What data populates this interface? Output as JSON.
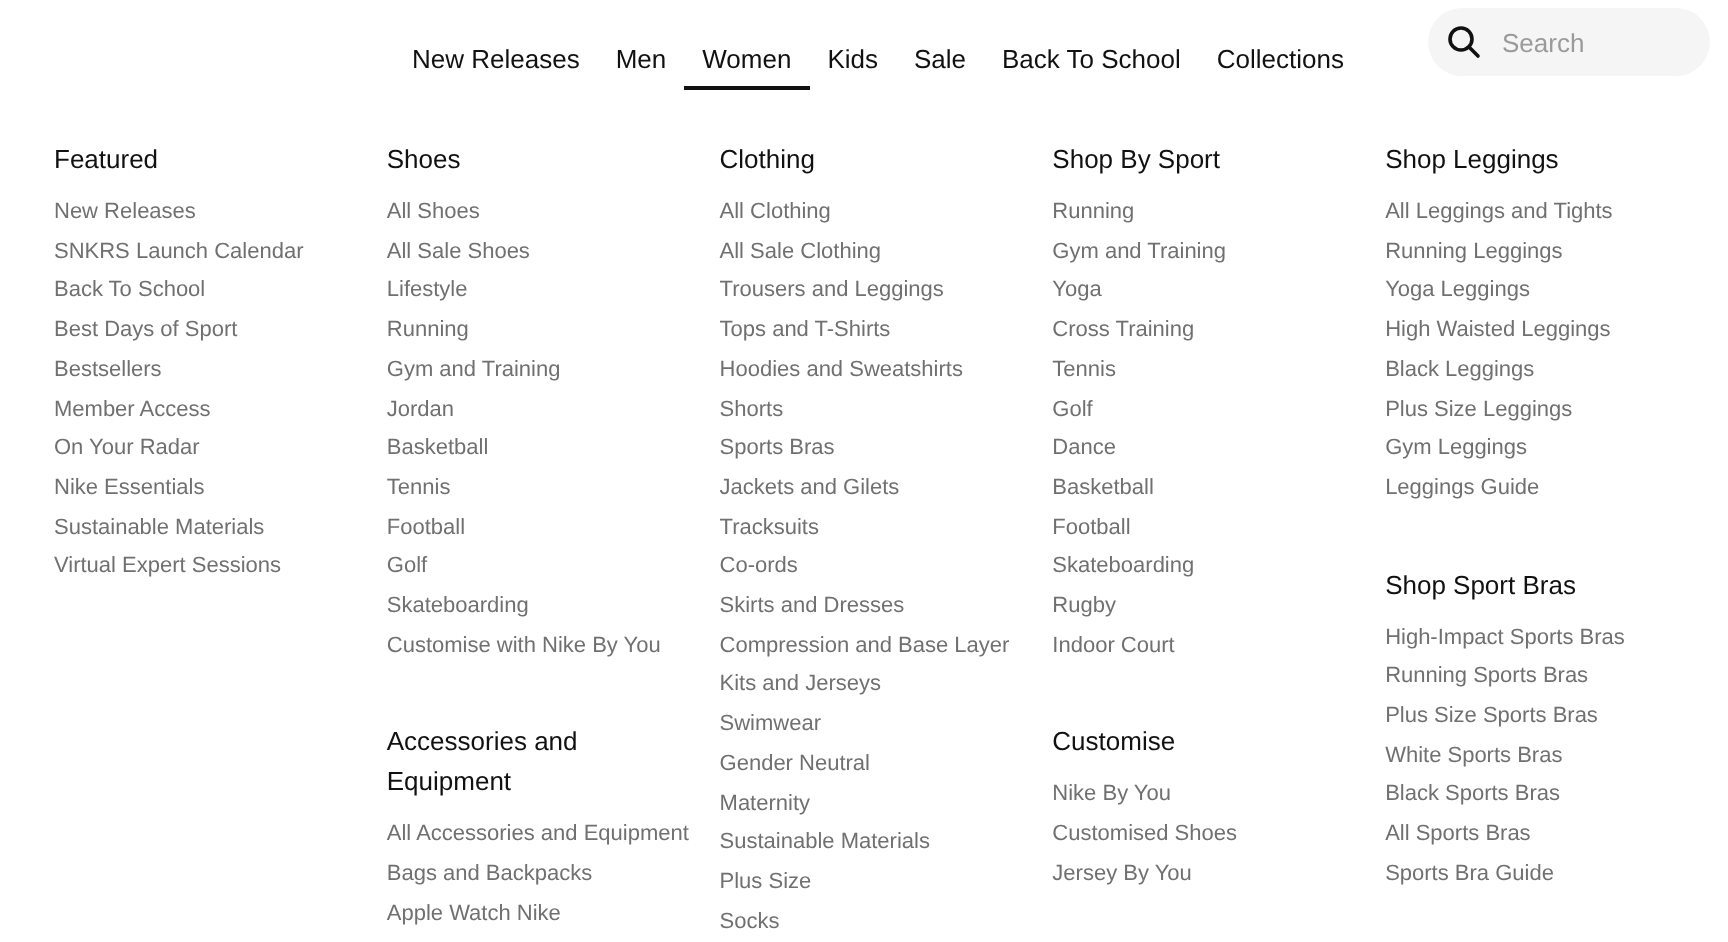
{
  "nav": [
    {
      "label": "New Releases",
      "selected": false
    },
    {
      "label": "Men",
      "selected": false
    },
    {
      "label": "Women",
      "selected": true
    },
    {
      "label": "Kids",
      "selected": false
    },
    {
      "label": "Sale",
      "selected": false
    },
    {
      "label": "Back To School",
      "selected": false
    },
    {
      "label": "Collections",
      "selected": false
    }
  ],
  "search": {
    "placeholder": "Search"
  },
  "columns": [
    {
      "sections": [
        {
          "heading": "Featured",
          "items": [
            "New Releases",
            "SNKRS Launch Calendar",
            "Back To School",
            "Best Days of Sport",
            "Bestsellers",
            "Member Access",
            "On Your Radar",
            "Nike Essentials",
            "Sustainable Materials",
            "Virtual Expert Sessions"
          ]
        }
      ]
    },
    {
      "sections": [
        {
          "heading": "Shoes",
          "items": [
            "All Shoes",
            "All Sale Shoes",
            "Lifestyle",
            "Running",
            "Gym and Training",
            "Jordan",
            "Basketball",
            "Tennis",
            "Football",
            "Golf",
            "Skateboarding",
            "Customise with Nike By You"
          ]
        },
        {
          "heading": "Accessories and Equipment",
          "items": [
            "All Accessories and Equipment",
            "Bags and Backpacks",
            "Apple Watch Nike"
          ]
        }
      ]
    },
    {
      "sections": [
        {
          "heading": "Clothing",
          "items": [
            "All Clothing",
            "All Sale Clothing",
            "Trousers and Leggings",
            "Tops and T-Shirts",
            "Hoodies and Sweatshirts",
            "Shorts",
            "Sports Bras",
            "Jackets and Gilets",
            "Tracksuits",
            "Co-ords",
            "Skirts and Dresses",
            "Compression and Base Layer",
            "Kits and Jerseys",
            "Swimwear",
            "Gender Neutral",
            "Maternity",
            "Sustainable Materials",
            "Plus Size",
            "Socks"
          ]
        }
      ]
    },
    {
      "sections": [
        {
          "heading": "Shop By Sport",
          "items": [
            "Running",
            "Gym and Training",
            "Yoga",
            "Cross Training",
            "Tennis",
            "Golf",
            "Dance",
            "Basketball",
            "Football",
            "Skateboarding",
            "Rugby",
            "Indoor Court"
          ]
        },
        {
          "heading": "Customise",
          "items": [
            "Nike By You",
            "Customised Shoes",
            "Jersey By You"
          ]
        }
      ]
    },
    {
      "sections": [
        {
          "heading": "Shop Leggings",
          "items": [
            "All Leggings and Tights",
            "Running Leggings",
            "Yoga Leggings",
            "High Waisted Leggings",
            "Black Leggings",
            "Plus Size Leggings",
            "Gym Leggings",
            "Leggings Guide"
          ]
        },
        {
          "heading": "Shop Sport Bras",
          "items": [
            "High-Impact Sports Bras",
            "Running Sports Bras",
            "Plus Size Sports Bras",
            "White Sports Bras",
            "Black Sports Bras",
            "All Sports Bras",
            "Sports Bra Guide"
          ]
        }
      ]
    }
  ]
}
